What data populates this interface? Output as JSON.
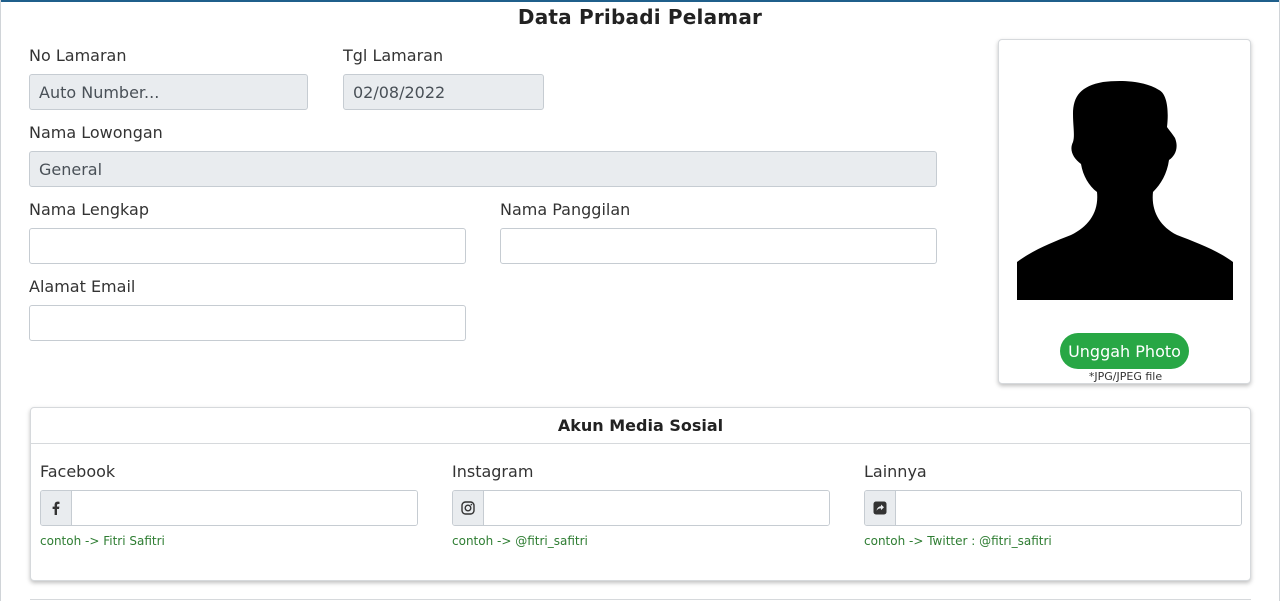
{
  "page": {
    "title": "Data Pribadi Pelamar"
  },
  "form": {
    "no_lamaran": {
      "label": "No Lamaran",
      "value": "Auto Number..."
    },
    "tgl_lamaran": {
      "label": "Tgl Lamaran",
      "value": "02/08/2022"
    },
    "nama_lowongan": {
      "label": "Nama Lowongan",
      "value": "General"
    },
    "nama_lengkap": {
      "label": "Nama Lengkap",
      "value": ""
    },
    "nama_panggilan": {
      "label": "Nama Panggilan",
      "value": ""
    },
    "alamat_email": {
      "label": "Alamat Email",
      "value": ""
    }
  },
  "photo": {
    "placeholder_icon": "person-silhouette-icon",
    "upload_label": "Unggah Photo",
    "note": "*JPG/JPEG file"
  },
  "social": {
    "title": "Akun Media Sosial",
    "facebook": {
      "label": "Facebook",
      "icon": "facebook-icon",
      "value": "",
      "hint": "contoh -> Fitri Safitri"
    },
    "instagram": {
      "label": "Instagram",
      "icon": "instagram-icon",
      "value": "",
      "hint": "contoh -> @fitri_safitri"
    },
    "lainnya": {
      "label": "Lainnya",
      "icon": "share-icon",
      "value": "",
      "hint": "contoh -> Twitter : @fitri_safitri"
    }
  },
  "colors": {
    "accent_top": "#1f5f8b",
    "upload_button": "#28a745",
    "hint_text": "#2e7d32",
    "readonly_bg": "#e9ecef"
  }
}
